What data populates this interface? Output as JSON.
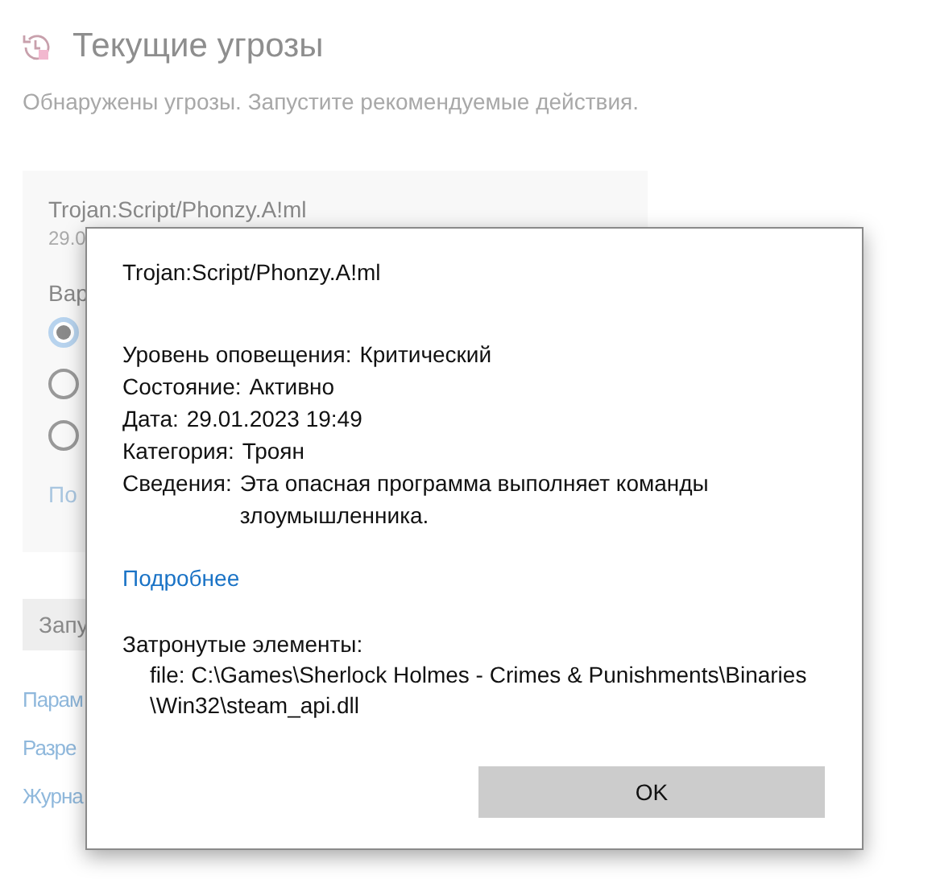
{
  "background": {
    "title": "Текущие угрозы",
    "subtitle": "Обнаружены угрозы. Запустите рекомендуемые действия.",
    "threat_card": {
      "name": "Trojan:Script/Phonzy.A!ml",
      "date": "29.0",
      "options_label": "Вар",
      "options": [
        {
          "selected": true
        },
        {
          "selected": false
        },
        {
          "selected": false
        }
      ],
      "link": "По"
    },
    "start_button": "Запу",
    "links": [
      "Парам",
      "Разре",
      "Журна"
    ]
  },
  "dialog": {
    "title": "Trojan:Script/Phonzy.A!ml",
    "details": [
      {
        "label": "Уровень оповещения:",
        "value": "Критический"
      },
      {
        "label": "Состояние:",
        "value": "Активно"
      },
      {
        "label": "Дата:",
        "value": "29.01.2023 19:49"
      },
      {
        "label": "Категория:",
        "value": "Троян"
      },
      {
        "label": "Сведения:",
        "value": "Эта опасная программа выполняет команды злоумышленника."
      }
    ],
    "more_link": "Подробнее",
    "affected_label": "Затронутые элементы:",
    "affected_items": [
      "file: C:\\Games\\Sherlock Holmes - Crimes & Punishments\\Binaries\\Win32\\steam_api.dll"
    ],
    "ok_button": "OK"
  }
}
